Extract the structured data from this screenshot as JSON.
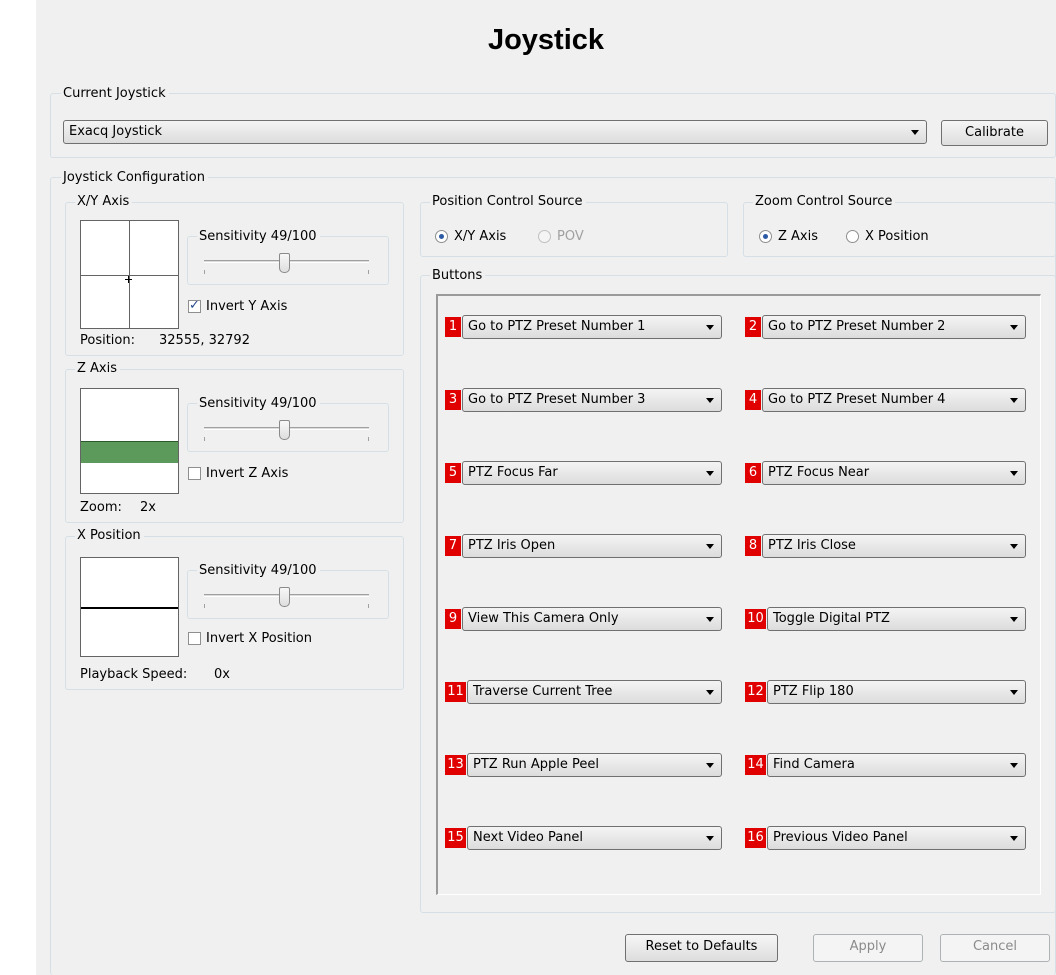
{
  "title": "Joystick",
  "current_joystick": {
    "group_label": "Current Joystick",
    "selected": "Exacq Joystick",
    "calibrate_label": "Calibrate"
  },
  "config": {
    "group_label": "Joystick Configuration",
    "xy_axis": {
      "label": "X/Y Axis",
      "sensitivity_label": "Sensitivity 49/100",
      "sensitivity": 49,
      "invert_label": "Invert Y Axis",
      "invert_checked": true,
      "position_label": "Position:",
      "position_value": "32555, 32792"
    },
    "z_axis": {
      "label": "Z Axis",
      "sensitivity_label": "Sensitivity 49/100",
      "sensitivity": 49,
      "invert_label": "Invert Z Axis",
      "invert_checked": false,
      "zoom_label": "Zoom:",
      "zoom_value": "2x",
      "bar_color": "#5c9a5c"
    },
    "x_position": {
      "label": "X Position",
      "sensitivity_label": "Sensitivity 49/100",
      "sensitivity": 49,
      "invert_label": "Invert X Position",
      "invert_checked": false,
      "speed_label": "Playback Speed:",
      "speed_value": "0x"
    }
  },
  "position_source": {
    "label": "Position Control Source",
    "options": [
      "X/Y Axis",
      "POV"
    ],
    "selected": "X/Y Axis"
  },
  "zoom_source": {
    "label": "Zoom Control Source",
    "options": [
      "Z Axis",
      "X Position"
    ],
    "selected": "Z Axis"
  },
  "buttons_group": {
    "label": "Buttons",
    "badge_color": "#e00000",
    "items": [
      {
        "num": "1",
        "action": "Go to PTZ Preset Number 1"
      },
      {
        "num": "2",
        "action": "Go to PTZ Preset Number 2"
      },
      {
        "num": "3",
        "action": "Go to PTZ Preset Number 3"
      },
      {
        "num": "4",
        "action": "Go to PTZ Preset Number 4"
      },
      {
        "num": "5",
        "action": "PTZ Focus Far"
      },
      {
        "num": "6",
        "action": "PTZ Focus Near"
      },
      {
        "num": "7",
        "action": "PTZ Iris Open"
      },
      {
        "num": "8",
        "action": "PTZ Iris Close"
      },
      {
        "num": "9",
        "action": "View This Camera Only"
      },
      {
        "num": "10",
        "action": "Toggle Digital PTZ"
      },
      {
        "num": "11",
        "action": "Traverse Current Tree"
      },
      {
        "num": "12",
        "action": "PTZ Flip 180"
      },
      {
        "num": "13",
        "action": "PTZ Run Apple Peel"
      },
      {
        "num": "14",
        "action": "Find Camera"
      },
      {
        "num": "15",
        "action": "Next Video Panel"
      },
      {
        "num": "16",
        "action": "Previous Video Panel"
      }
    ]
  },
  "footer": {
    "reset_label": "Reset to Defaults",
    "apply_label": "Apply",
    "cancel_label": "Cancel"
  }
}
